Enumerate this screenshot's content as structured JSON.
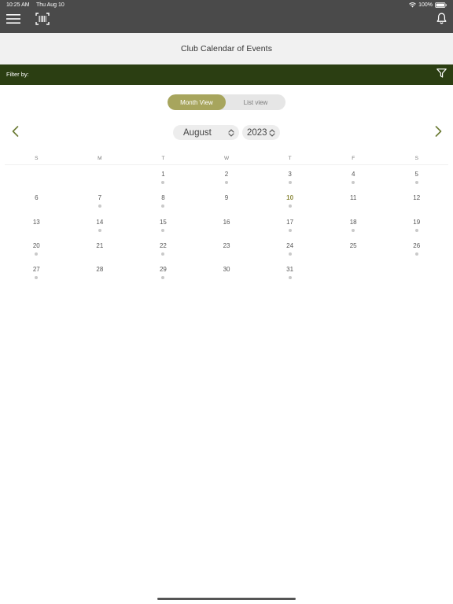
{
  "status_bar": {
    "time": "10:25 AM",
    "date": "Thu Aug 10",
    "battery": "100%",
    "wifi_icon": "wifi-icon",
    "battery_icon": "battery-icon"
  },
  "nav": {
    "menu_icon": "hamburger-menu-icon",
    "barcode_icon": "barcode-scan-icon",
    "bell_icon": "notification-bell-icon"
  },
  "page": {
    "title": "Club Calendar of Events"
  },
  "filter": {
    "label": "Filter by:",
    "icon": "filter-funnel-icon"
  },
  "view_toggle": {
    "month_view": "Month View",
    "list_view": "List view",
    "selected": "Month View"
  },
  "month_nav": {
    "prev_icon": "chevron-left-icon",
    "next_icon": "chevron-right-icon",
    "month": "August",
    "year": "2023",
    "picker_icon": "up-down-chevron-icon"
  },
  "calendar": {
    "weekdays": [
      "S",
      "M",
      "T",
      "W",
      "T",
      "F",
      "S"
    ],
    "today": "10",
    "weeks": [
      [
        {
          "day": ""
        },
        {
          "day": ""
        },
        {
          "day": "1",
          "event": true
        },
        {
          "day": "2",
          "event": true
        },
        {
          "day": "3",
          "event": true
        },
        {
          "day": "4",
          "event": true
        },
        {
          "day": "5",
          "event": true
        }
      ],
      [
        {
          "day": "6"
        },
        {
          "day": "7",
          "event": true
        },
        {
          "day": "8",
          "event": true
        },
        {
          "day": "9"
        },
        {
          "day": "10",
          "event": true,
          "today": true
        },
        {
          "day": "11"
        },
        {
          "day": "12"
        }
      ],
      [
        {
          "day": "13"
        },
        {
          "day": "14",
          "event": true
        },
        {
          "day": "15",
          "event": true
        },
        {
          "day": "16"
        },
        {
          "day": "17",
          "event": true
        },
        {
          "day": "18",
          "event": true
        },
        {
          "day": "19",
          "event": true
        }
      ],
      [
        {
          "day": "20",
          "event": true
        },
        {
          "day": "21"
        },
        {
          "day": "22",
          "event": true
        },
        {
          "day": "23"
        },
        {
          "day": "24",
          "event": true
        },
        {
          "day": "25"
        },
        {
          "day": "26",
          "event": true
        }
      ],
      [
        {
          "day": "27",
          "event": true
        },
        {
          "day": "28"
        },
        {
          "day": "29",
          "event": true
        },
        {
          "day": "30"
        },
        {
          "day": "31",
          "event": true
        },
        {
          "day": ""
        },
        {
          "day": ""
        }
      ]
    ]
  },
  "colors": {
    "top_bar": "#4a4a4a",
    "filter_bar": "#2b3e12",
    "accent": "#a7a55d",
    "today": "#8e8b3f",
    "event_dot": "#c9c9c9",
    "nav_arrow": "#6b7a33"
  }
}
